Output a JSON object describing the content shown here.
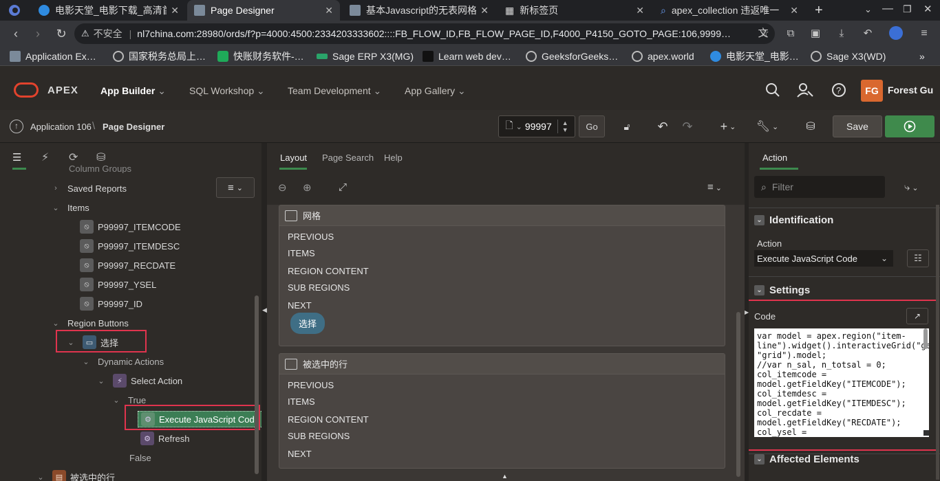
{
  "browser": {
    "tabs": [
      {
        "title": "电影天堂_电影下载_高清首",
        "active": false
      },
      {
        "title": "Page Designer",
        "active": true
      },
      {
        "title": "基本Javascript的无表网格",
        "active": false
      },
      {
        "title": "新标签页",
        "active": false
      },
      {
        "title": "apex_collection 违返唯一",
        "active": false
      }
    ],
    "insecure_label": "不安全",
    "url": "nl7china.com:28980/ords/f?p=4000:4500:2334203333602::::FB_FLOW_ID,FB_FLOW_PAGE_ID,F4000_P4150_GOTO_PAGE:106,9999…",
    "bookmarks": [
      "Application Ex…",
      "国家税务总局上…",
      "快账财务软件-…",
      "Sage ERP X3(MG)",
      "Learn web dev…",
      "GeeksforGeeks…",
      "apex.world",
      "电影天堂_电影…",
      "Sage X3(WD)"
    ]
  },
  "apex_header": {
    "brand": "APEX",
    "menus": [
      "App Builder",
      "SQL Workshop",
      "Team Development",
      "App Gallery"
    ],
    "user_initials": "FG",
    "user_name": "Forest Gu"
  },
  "toolbar": {
    "breadcrumb_app": "Application 106",
    "breadcrumb_page": "Page Designer",
    "page_number": "99997",
    "go_label": "Go",
    "save_label": "Save"
  },
  "left_tree": [
    {
      "label": "Column Groups",
      "level": 2
    },
    {
      "label": "Saved Reports",
      "level": 2
    },
    {
      "label": "Items",
      "level": 2
    },
    {
      "label": "P99997_ITEMCODE",
      "level": 3
    },
    {
      "label": "P99997_ITEMDESC",
      "level": 3
    },
    {
      "label": "P99997_RECDATE",
      "level": 3
    },
    {
      "label": "P99997_YSEL",
      "level": 3
    },
    {
      "label": "P99997_ID",
      "level": 3
    },
    {
      "label": "Region Buttons",
      "level": 2
    },
    {
      "label": "选择",
      "level": 3
    },
    {
      "label": "Dynamic Actions",
      "level": 4
    },
    {
      "label": "Select Action",
      "level": 5
    },
    {
      "label": "True",
      "level": 6
    },
    {
      "label": "Execute JavaScript Code",
      "level": 7
    },
    {
      "label": "Refresh",
      "level": 7
    },
    {
      "label": "False",
      "level": 6
    },
    {
      "label": "被选中的行",
      "level": 2
    }
  ],
  "center": {
    "tabs": [
      "Layout",
      "Page Search",
      "Help"
    ],
    "region1_title": "网格",
    "region2_title": "被选中的行",
    "slots": [
      "PREVIOUS",
      "ITEMS",
      "REGION CONTENT",
      "SUB REGIONS",
      "NEXT"
    ],
    "button_label": "选择"
  },
  "right": {
    "tab": "Action",
    "filter_placeholder": "Filter",
    "section_identification": "Identification",
    "action_label": "Action",
    "action_value": "Execute JavaScript Code",
    "section_settings": "Settings",
    "code_label": "Code",
    "code": "var model = apex.region(\"item-line\").widget().interactiveGrid(\"getViews\", \"grid\").model;\n//var n_sal, n_totsal = 0;\ncol_itemcode =\nmodel.getFieldKey(\"ITEMCODE\");\ncol_itemdesc =\nmodel.getFieldKey(\"ITEMDESC\");\ncol_recdate =\nmodel.getFieldKey(\"RECDATE\");\ncol_ysel =",
    "section_affected": "Affected Elements"
  }
}
